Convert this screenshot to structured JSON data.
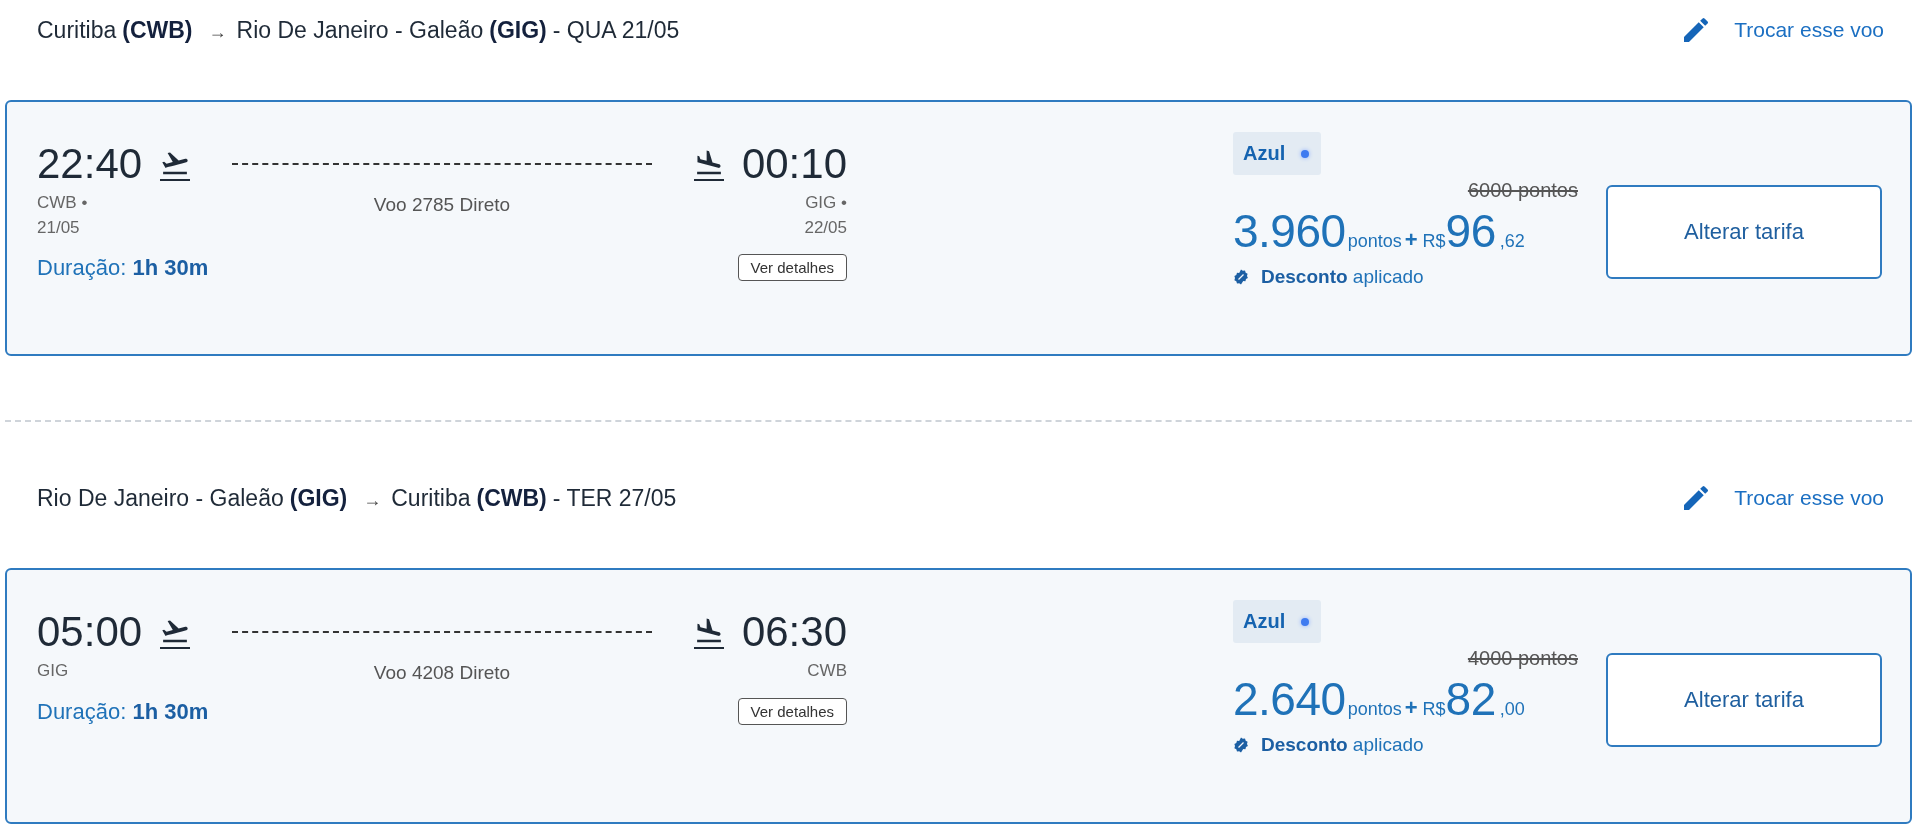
{
  "legs": [
    {
      "route": {
        "origin_name": "Curitiba",
        "origin_code": "(CWB)",
        "arrow": "→",
        "destination_name": "Rio De Janeiro - Galeão",
        "destination_code": "(GIG)",
        "day": "- QUA 21/05"
      },
      "change_link": "Trocar esse voo",
      "flight": {
        "depart_time": "22:40",
        "depart_code": "CWB •",
        "depart_date": "21/05",
        "arrive_time": "00:10",
        "arrive_code": "GIG •",
        "arrive_date": "22/05",
        "label": "Voo 2785 Direto",
        "duration_label": "Duração:",
        "duration": "1h 30m",
        "details_button": "Ver detalhes"
      },
      "fare": {
        "airline": "Azul",
        "old_price": "6000 pontos",
        "points": "3.960",
        "points_unit": "pontos",
        "plus": "+",
        "currency": "R$",
        "amount": "96",
        "cents": ",62",
        "discount": "**Desconto** aplicado",
        "button": "Alterar tarifa"
      }
    },
    {
      "route": {
        "origin_name": "Rio De Janeiro - Galeão",
        "origin_code": "(GIG)",
        "arrow": "→",
        "destination_name": "Curitiba",
        "destination_code": "(CWB)",
        "day": "- TER 27/05"
      },
      "change_link": "Trocar esse voo",
      "flight": {
        "depart_time": "05:00",
        "depart_code": "GIG",
        "arrive_time": "06:30",
        "arrive_code": "CWB",
        "label": "Voo 4208 Direto",
        "duration_label": "Duração:",
        "duration": "1h 30m",
        "details_button": "Ver detalhes"
      },
      "fare": {
        "airline": "Azul",
        "old_price": "4000 pontos",
        "points": "2.640",
        "points_unit": "pontos",
        "plus": "+",
        "currency": "R$",
        "amount": "82",
        "cents": ",00",
        "discount": "**Desconto** aplicado",
        "button": "Alterar tarifa"
      }
    }
  ]
}
